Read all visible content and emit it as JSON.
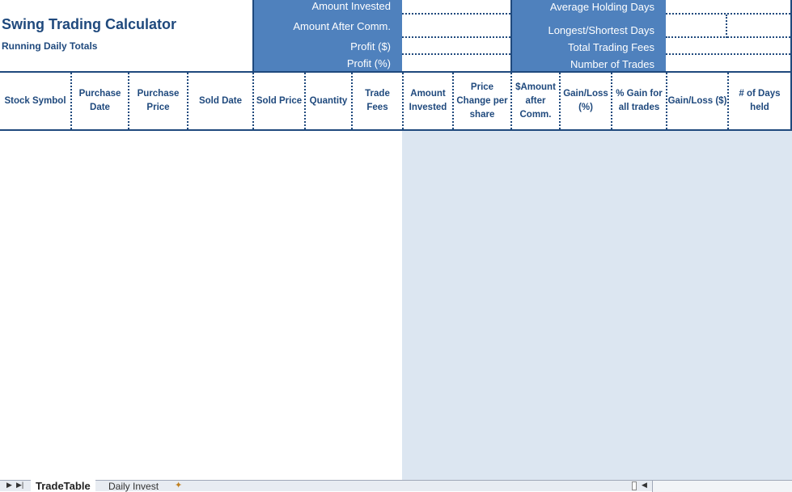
{
  "header": {
    "title": "Swing Trading Calculator",
    "subtitle": "Running Daily Totals"
  },
  "summary_left": [
    {
      "label": "Amount Invested",
      "value": ""
    },
    {
      "label": "Amount After Comm.",
      "value": ""
    },
    {
      "label": "Profit ($)",
      "value": ""
    },
    {
      "label": "Profit (%)",
      "value": ""
    }
  ],
  "summary_right": [
    {
      "label": "Average Holding Days",
      "value": ""
    },
    {
      "label": "Longest/Shortest Days",
      "value": "",
      "value2": ""
    },
    {
      "label": "Total Trading Fees",
      "value": ""
    },
    {
      "label": "Number of Trades",
      "value": ""
    }
  ],
  "columns": [
    "Stock Symbol",
    "Purchase Date",
    "Purchase Price",
    "Sold Date",
    "Sold Price",
    "Quantity",
    "Trade Fees",
    "Amount Invested",
    "Price Change per share",
    "$Amount after Comm.",
    "Gain/Loss (%)",
    "% Gain for all trades",
    "Gain/Loss ($)",
    "# of Days held"
  ],
  "sheet_tabs": {
    "active": "TradeTable",
    "tabs": [
      "TradeTable",
      "Daily Invest"
    ]
  },
  "colors": {
    "accent": "#4f81bd",
    "text": "#1f497d",
    "computed_area": "#dce6f1"
  }
}
